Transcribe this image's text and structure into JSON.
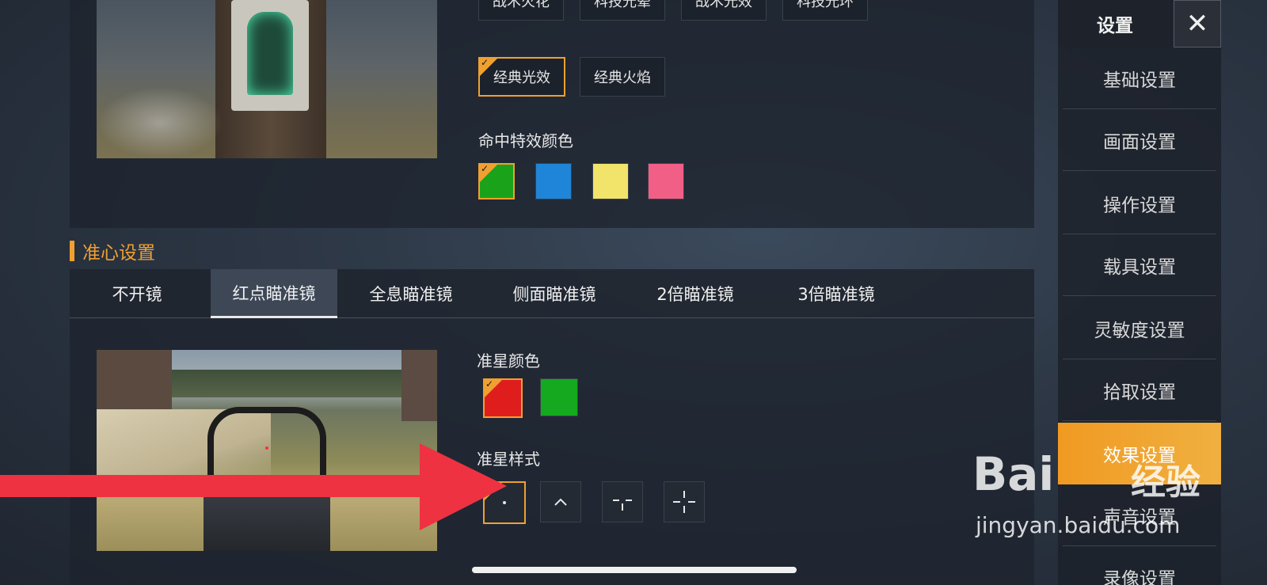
{
  "hit_effect": {
    "row1_options": [
      "战术火花",
      "科技光晕",
      "战术光效",
      "科技光环"
    ],
    "row2_options": [
      {
        "label": "经典光效",
        "selected": true
      },
      {
        "label": "经典火焰",
        "selected": false
      }
    ],
    "color_label": "命中特效颜色",
    "colors": [
      {
        "name": "green",
        "hex": "#1aa31a",
        "selected": true
      },
      {
        "name": "blue",
        "hex": "#1f85d8",
        "selected": false
      },
      {
        "name": "yellow",
        "hex": "#f2e46a",
        "selected": false
      },
      {
        "name": "pink",
        "hex": "#f25f86",
        "selected": false
      }
    ]
  },
  "crosshair": {
    "section_title": "准心设置",
    "tabs": [
      {
        "label": "不开镜",
        "active": false
      },
      {
        "label": "红点瞄准镜",
        "active": true
      },
      {
        "label": "全息瞄准镜",
        "active": false
      },
      {
        "label": "侧面瞄准镜",
        "active": false
      },
      {
        "label": "2倍瞄准镜",
        "active": false
      },
      {
        "label": "3倍瞄准镜",
        "active": false
      }
    ],
    "color_label": "准星颜色",
    "colors": [
      {
        "name": "red",
        "hex": "#e01d1d",
        "selected": true
      },
      {
        "name": "green",
        "hex": "#14a91e",
        "selected": false
      }
    ],
    "style_label": "准星样式",
    "styles": [
      {
        "icon": "dot-icon",
        "selected": true
      },
      {
        "icon": "chevron-up-icon",
        "selected": false
      },
      {
        "icon": "t-crosshair-icon",
        "selected": false
      },
      {
        "icon": "cross-crosshair-icon",
        "selected": false
      }
    ]
  },
  "sidebar": {
    "title": "设置",
    "close_icon": "close-icon",
    "items": [
      {
        "label": "基础设置",
        "active": false
      },
      {
        "label": "画面设置",
        "active": false
      },
      {
        "label": "操作设置",
        "active": false
      },
      {
        "label": "载具设置",
        "active": false
      },
      {
        "label": "灵敏度设置",
        "active": false
      },
      {
        "label": "拾取设置",
        "active": false
      },
      {
        "label": "效果设置",
        "active": true
      },
      {
        "label": "声音设置",
        "active": false
      },
      {
        "label": "录像设置",
        "active": false
      }
    ]
  },
  "watermark": {
    "logo": "Bai",
    "logo_cn": "经验",
    "url": "jingyan.baidu.com"
  },
  "accent_color": "#f0a030"
}
